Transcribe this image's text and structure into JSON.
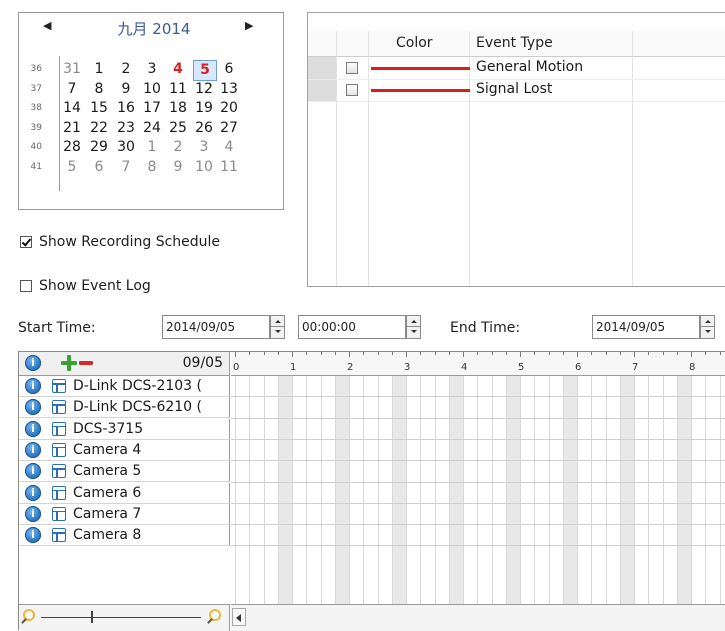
{
  "calendar": {
    "title": "九月 2014",
    "prev_icon": "triangle-left-icon",
    "next_icon": "triangle-right-icon",
    "weeks": [
      {
        "num": "36",
        "days": [
          {
            "d": "31",
            "type": "other"
          },
          {
            "d": "1",
            "type": "cur"
          },
          {
            "d": "2",
            "type": "cur"
          },
          {
            "d": "3",
            "type": "cur"
          },
          {
            "d": "4",
            "type": "today"
          },
          {
            "d": "5",
            "type": "sel"
          },
          {
            "d": "6",
            "type": "cur"
          }
        ]
      },
      {
        "num": "37",
        "days": [
          {
            "d": "7",
            "type": "cur"
          },
          {
            "d": "8",
            "type": "cur"
          },
          {
            "d": "9",
            "type": "cur"
          },
          {
            "d": "10",
            "type": "cur"
          },
          {
            "d": "11",
            "type": "cur"
          },
          {
            "d": "12",
            "type": "cur"
          },
          {
            "d": "13",
            "type": "cur"
          }
        ]
      },
      {
        "num": "38",
        "days": [
          {
            "d": "14",
            "type": "cur"
          },
          {
            "d": "15",
            "type": "cur"
          },
          {
            "d": "16",
            "type": "cur"
          },
          {
            "d": "17",
            "type": "cur"
          },
          {
            "d": "18",
            "type": "cur"
          },
          {
            "d": "19",
            "type": "cur"
          },
          {
            "d": "20",
            "type": "cur"
          }
        ]
      },
      {
        "num": "39",
        "days": [
          {
            "d": "21",
            "type": "cur"
          },
          {
            "d": "22",
            "type": "cur"
          },
          {
            "d": "23",
            "type": "cur"
          },
          {
            "d": "24",
            "type": "cur"
          },
          {
            "d": "25",
            "type": "cur"
          },
          {
            "d": "26",
            "type": "cur"
          },
          {
            "d": "27",
            "type": "cur"
          }
        ]
      },
      {
        "num": "40",
        "days": [
          {
            "d": "28",
            "type": "cur"
          },
          {
            "d": "29",
            "type": "cur"
          },
          {
            "d": "30",
            "type": "cur"
          },
          {
            "d": "1",
            "type": "other"
          },
          {
            "d": "2",
            "type": "other"
          },
          {
            "d": "3",
            "type": "other"
          },
          {
            "d": "4",
            "type": "other"
          }
        ]
      },
      {
        "num": "41",
        "days": [
          {
            "d": "5",
            "type": "other"
          },
          {
            "d": "6",
            "type": "other"
          },
          {
            "d": "7",
            "type": "other"
          },
          {
            "d": "8",
            "type": "other"
          },
          {
            "d": "9",
            "type": "other"
          },
          {
            "d": "10",
            "type": "other"
          },
          {
            "d": "11",
            "type": "other"
          }
        ]
      }
    ]
  },
  "options": {
    "show_recording_schedule": {
      "label": "Show Recording Schedule",
      "checked": true
    },
    "show_event_log": {
      "label": "Show Event Log",
      "checked": false
    }
  },
  "events": {
    "columns": {
      "color": "Color",
      "event_type": "Event Type"
    },
    "rows": [
      {
        "name": "General Motion",
        "color": "#d62020",
        "checked": false
      },
      {
        "name": "Signal Lost",
        "color": "#d62020",
        "checked": false
      }
    ]
  },
  "timebar": {
    "start_label": "Start Time:",
    "start_date": "2014/09/05",
    "start_time": "00:00:00",
    "end_label": "End Time:",
    "end_date": "2014/09/05"
  },
  "cameras": {
    "header_date": "09/05",
    "add_icon": "plus-icon",
    "remove_icon": "minus-icon",
    "info_icon": "info-icon",
    "camera_icon": "camera-grid-icon",
    "list": [
      "D-Link DCS-2103 (",
      "D-Link DCS-6210 (",
      "DCS-3715",
      "Camera 4",
      "Camera 5",
      "Camera 6",
      "Camera 7",
      "Camera 8"
    ]
  },
  "timeline": {
    "hours": [
      "0",
      "1",
      "2",
      "3",
      "4",
      "5",
      "6",
      "7",
      "8"
    ]
  },
  "zoom": {
    "zoom_out_icon": "zoom-out-icon",
    "zoom_in_icon": "zoom-in-icon"
  }
}
